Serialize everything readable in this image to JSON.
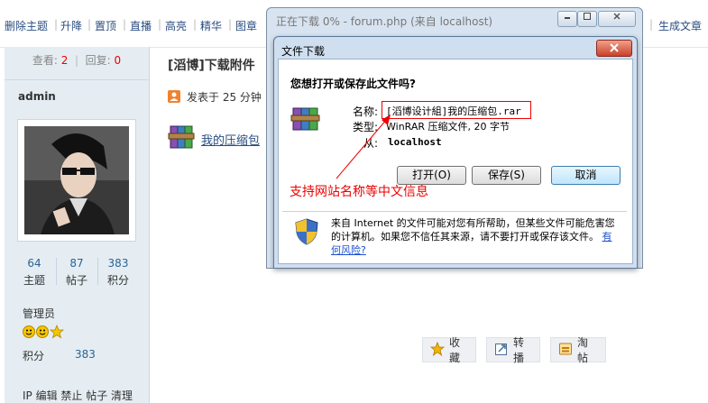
{
  "toolbar": {
    "items": [
      "删除主题",
      "升降",
      "置顶",
      "直播",
      "高亮",
      "精华",
      "图章"
    ],
    "right_item": "生成文章"
  },
  "sidebar": {
    "views_label": "查看:",
    "views_value": "2",
    "replies_label": "回复:",
    "replies_value": "0",
    "username": "admin",
    "stats": [
      {
        "value": "64",
        "label": "主题"
      },
      {
        "value": "87",
        "label": "帖子"
      },
      {
        "value": "383",
        "label": "积分"
      }
    ],
    "rank": "管理员",
    "jifen_label": "积分",
    "jifen_value": "383",
    "admin_links": "IP 编辑 禁止 帖子 清理"
  },
  "post": {
    "title": "[滔博]下载附件",
    "meta": "发表于  25 分钟",
    "attachment_label": "我的压缩包"
  },
  "actions": {
    "favorite": "收藏",
    "share": "转播",
    "bookmark": "淘帖"
  },
  "ie_window": {
    "title": "正在下载 0% - forum.php (来自 localhost)"
  },
  "dialog": {
    "title": "文件下载",
    "question": "您想打开或保存此文件吗?",
    "name_label": "名称:",
    "name_value": "[滔博设计組]我的压缩包.rar",
    "type_label": "类型:",
    "type_value": "WinRAR 压缩文件, 20 字节",
    "from_label": "从:",
    "from_value": "localhost",
    "open_button": "打开(O)",
    "save_button": "保存(S)",
    "cancel_button": "取消",
    "annotation": "支持网站名称等中文信息",
    "warning": "来自 Internet 的文件可能对您有所帮助，但某些文件可能危害您的计算机。如果您不信任其来源，请不要打开或保存该文件。",
    "risk_link": "有何风险?"
  },
  "colors": {
    "annotation_red": "#ee0000",
    "link_blue": "#2a4d80",
    "sidebar_bg": "#e5edf2"
  }
}
